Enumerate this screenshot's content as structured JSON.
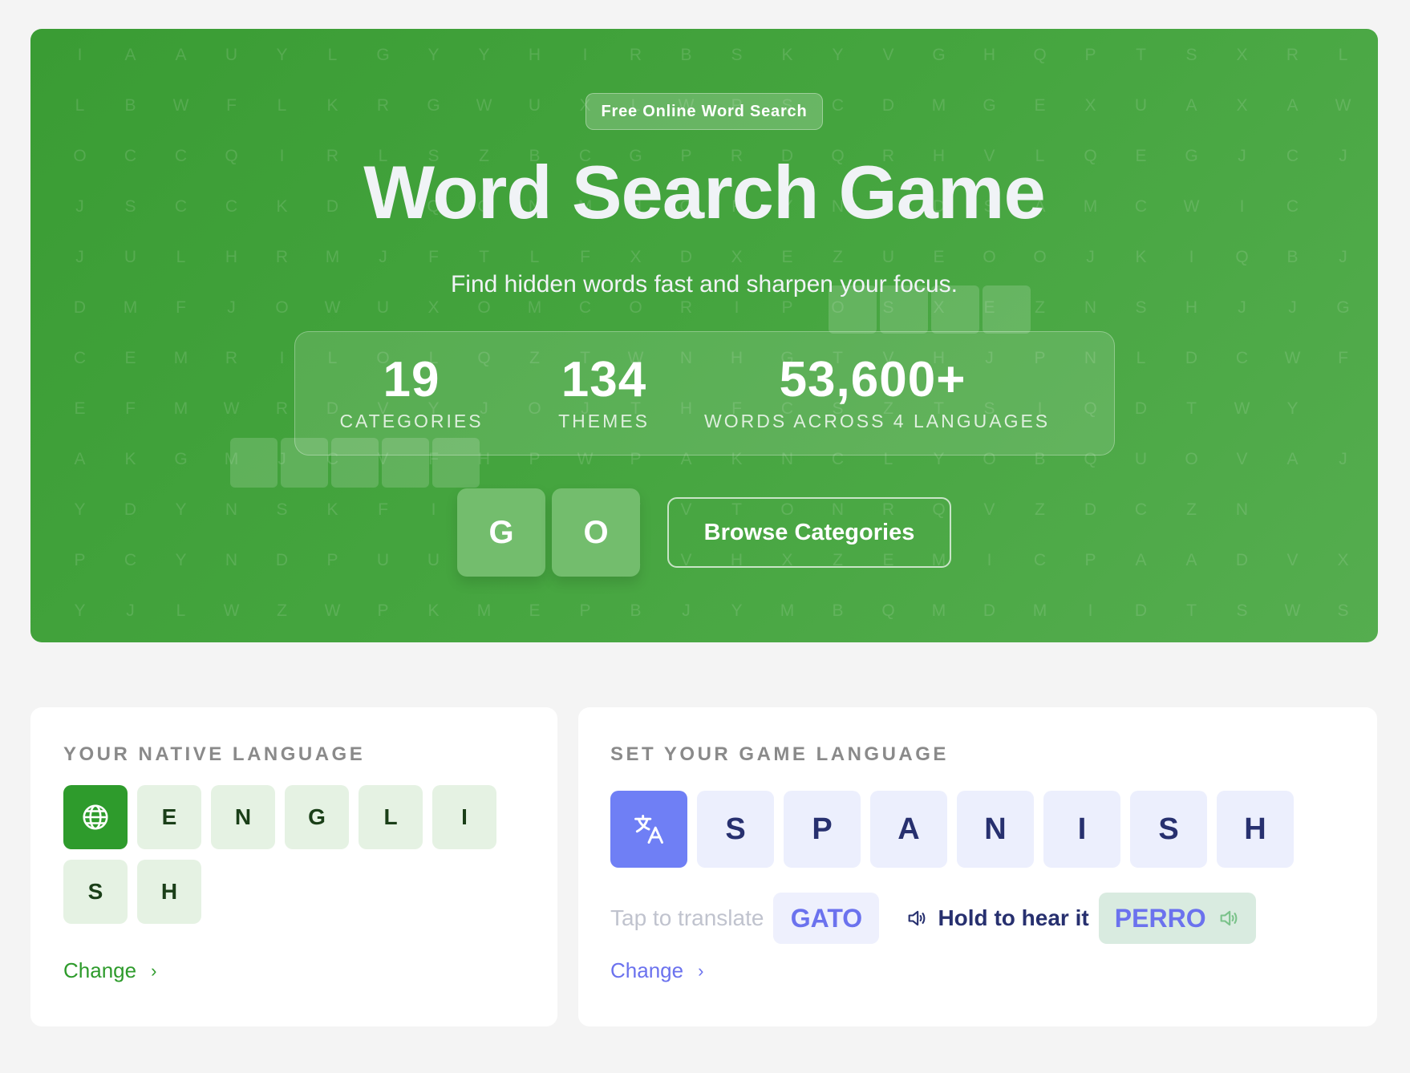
{
  "hero": {
    "badge": "Free Online Word Search",
    "title": "Word Search Game",
    "subtitle": "Find hidden words fast and sharpen your focus.",
    "stats": [
      {
        "value": "19",
        "label": "CATEGORIES"
      },
      {
        "value": "134",
        "label": "THEMES"
      },
      {
        "value": "53,600+",
        "label": "WORDS ACROSS 4 LANGUAGES"
      }
    ],
    "go_tiles": [
      "G",
      "O"
    ],
    "browse_label": "Browse Categories",
    "background_letters": [
      "IAAUYLGYYHIRBSKYVGHQPTSXRL",
      "LBWFLKRGWUXLWPSCDMGEXUAXAW",
      "OCCQIRLSZBCGPRDQRHVLQEGJCJ",
      "JSCCKDPQQNMHGFYNDDSAMCWIC",
      "JULHRMJFTLFXDXEZUEOOJKIQBJ",
      "DMFJOWUXOMCORIPOSXEZNSHJJGV",
      "CEMRILOLQZTWNHGTVHJPNLDCWF",
      "EFMWRDVYJOJTHFCSZTSIQDTWY",
      "AKGMJCVFHPWPAKNCLYOBQUOVAJT",
      "YDYNSKFIDGKYVTONRQVZDCZN",
      "PCYNDPUUNYYZVHXZEMICPAADVX",
      "YJLWZWPKMEPBJYMBQMDMIDTSWSU"
    ]
  },
  "native": {
    "label": "YOUR NATIVE LANGUAGE",
    "icon": "globe-icon",
    "letters": [
      "E",
      "N",
      "G",
      "L",
      "I",
      "S",
      "H"
    ],
    "change": "Change"
  },
  "game": {
    "label": "SET YOUR GAME LANGUAGE",
    "icon": "translate-icon",
    "letters": [
      "S",
      "P",
      "A",
      "N",
      "I",
      "S",
      "H"
    ],
    "tap_text": "Tap to translate",
    "word1": "GATO",
    "hold_text": "Hold to hear it",
    "word2": "PERRO",
    "change": "Change"
  },
  "colors": {
    "hero_green": "#45a53f",
    "native_accent": "#2e9b2c",
    "game_accent": "#6f7ff5",
    "game_text": "#27306f"
  }
}
